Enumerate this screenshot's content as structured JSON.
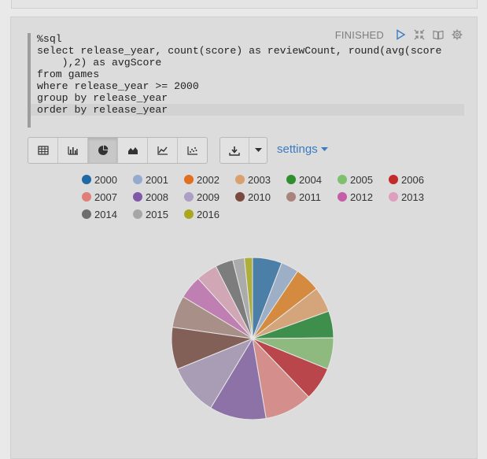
{
  "status": "FINISHED",
  "code_lines": [
    "%sql",
    "select release_year, count(score) as reviewCount, round(avg(score",
    "    ),2) as avgScore",
    "from games",
    "where release_year >= 2000",
    "group by release_year",
    "order by release_year"
  ],
  "settings_label": "settings",
  "toolbar_buttons": [
    "table",
    "bar-chart",
    "pie-chart",
    "area-chart",
    "line-chart",
    "scatter-chart"
  ],
  "active_view": "pie-chart",
  "chart_data": {
    "type": "pie",
    "legend_position": "top",
    "slices": [
      {
        "label": "2000",
        "value": 5.8,
        "color": "#4c7fa8"
      },
      {
        "label": "2001",
        "value": 3.5,
        "color": "#9daec7"
      },
      {
        "label": "2002",
        "value": 5.0,
        "color": "#d48a3f"
      },
      {
        "label": "2003",
        "value": 5.0,
        "color": "#d4a47a"
      },
      {
        "label": "2004",
        "value": 5.3,
        "color": "#3f8f4c"
      },
      {
        "label": "2005",
        "value": 6.2,
        "color": "#8fba7f"
      },
      {
        "label": "2006",
        "value": 6.6,
        "color": "#b8464a"
      },
      {
        "label": "2007",
        "value": 9.4,
        "color": "#d48f8d"
      },
      {
        "label": "2008",
        "value": 11.2,
        "color": "#8d72a7"
      },
      {
        "label": "2009",
        "value": 10.1,
        "color": "#a99db5"
      },
      {
        "label": "2010",
        "value": 8.3,
        "color": "#836057"
      },
      {
        "label": "2011",
        "value": 6.3,
        "color": "#a88f88"
      },
      {
        "label": "2012",
        "value": 4.6,
        "color": "#c07fb3"
      },
      {
        "label": "2013",
        "value": 4.2,
        "color": "#d1a6b5"
      },
      {
        "label": "2014",
        "value": 3.5,
        "color": "#7d7d7d"
      },
      {
        "label": "2015",
        "value": 2.3,
        "color": "#ababab"
      },
      {
        "label": "2016",
        "value": 1.6,
        "color": "#aeae3c"
      }
    ],
    "legend_colors": {
      "2000": "#1f6aa5",
      "2001": "#94abcf",
      "2002": "#e07020",
      "2003": "#d9a070",
      "2004": "#2f8f2f",
      "2005": "#7fc06f",
      "2006": "#c22b2b",
      "2007": "#e07f78",
      "2008": "#8058a8",
      "2009": "#ad9ec4",
      "2010": "#7a4a3e",
      "2011": "#a8847c",
      "2012": "#c45ea8",
      "2013": "#dc9fbd",
      "2014": "#6e6e6e",
      "2015": "#a6a6a6",
      "2016": "#a8a820"
    }
  }
}
